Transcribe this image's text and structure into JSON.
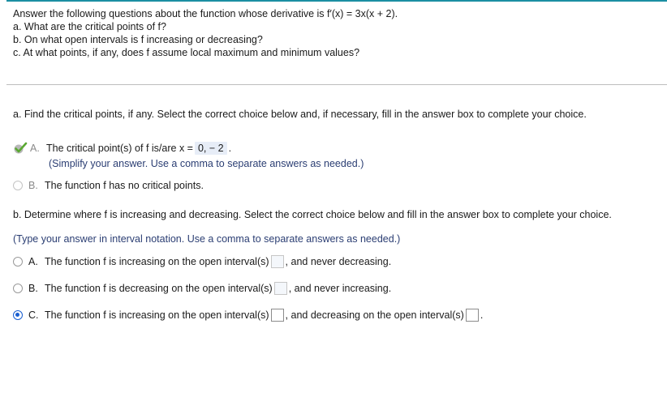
{
  "question": {
    "line1": "Answer the following questions about the function whose derivative is f′(x) = 3x(x + 2).",
    "line_a": "a. What are the critical points of f?",
    "line_b": "b. On what open intervals is f increasing or decreasing?",
    "line_c": "c. At what points, if any, does f assume local maximum and minimum values?"
  },
  "part_a": {
    "heading": "a. Find the critical points, if any. Select the correct choice below and, if necessary, fill in the answer box to complete your choice.",
    "choice_a": {
      "letter": "A.",
      "text_before": "The critical point(s) of f is/are x =",
      "answer": "0, − 2",
      "text_after": ".",
      "hint": "(Simplify your answer. Use a comma to separate answers as needed.)"
    },
    "choice_b": {
      "letter": "B.",
      "text": "The function f has no critical points."
    }
  },
  "part_b": {
    "heading": "b. Determine where f is increasing and decreasing. Select the correct choice below and fill in the answer box to complete your choice.",
    "hint": "(Type your answer in interval notation. Use a comma to separate answers as needed.)",
    "choice_a": {
      "letter": "A.",
      "text_before": "The function f is increasing on the open interval(s)",
      "text_after": ", and never decreasing."
    },
    "choice_b": {
      "letter": "B.",
      "text_before": "The function f is decreasing on the open interval(s)",
      "text_after": ", and never increasing."
    },
    "choice_c": {
      "letter": "C.",
      "text_before": "The function f is increasing on the open interval(s)",
      "text_middle": ", and decreasing on the open interval(s)",
      "text_after": "."
    },
    "selected": "C"
  },
  "colors": {
    "accent_rule": "#1b8fa3",
    "selected_radio": "#1a5fd1",
    "correct_check": "#5aa832",
    "hint_text": "#2b3e73"
  },
  "icons": {
    "correct": "checkmark-icon",
    "radio": "radio-button"
  }
}
